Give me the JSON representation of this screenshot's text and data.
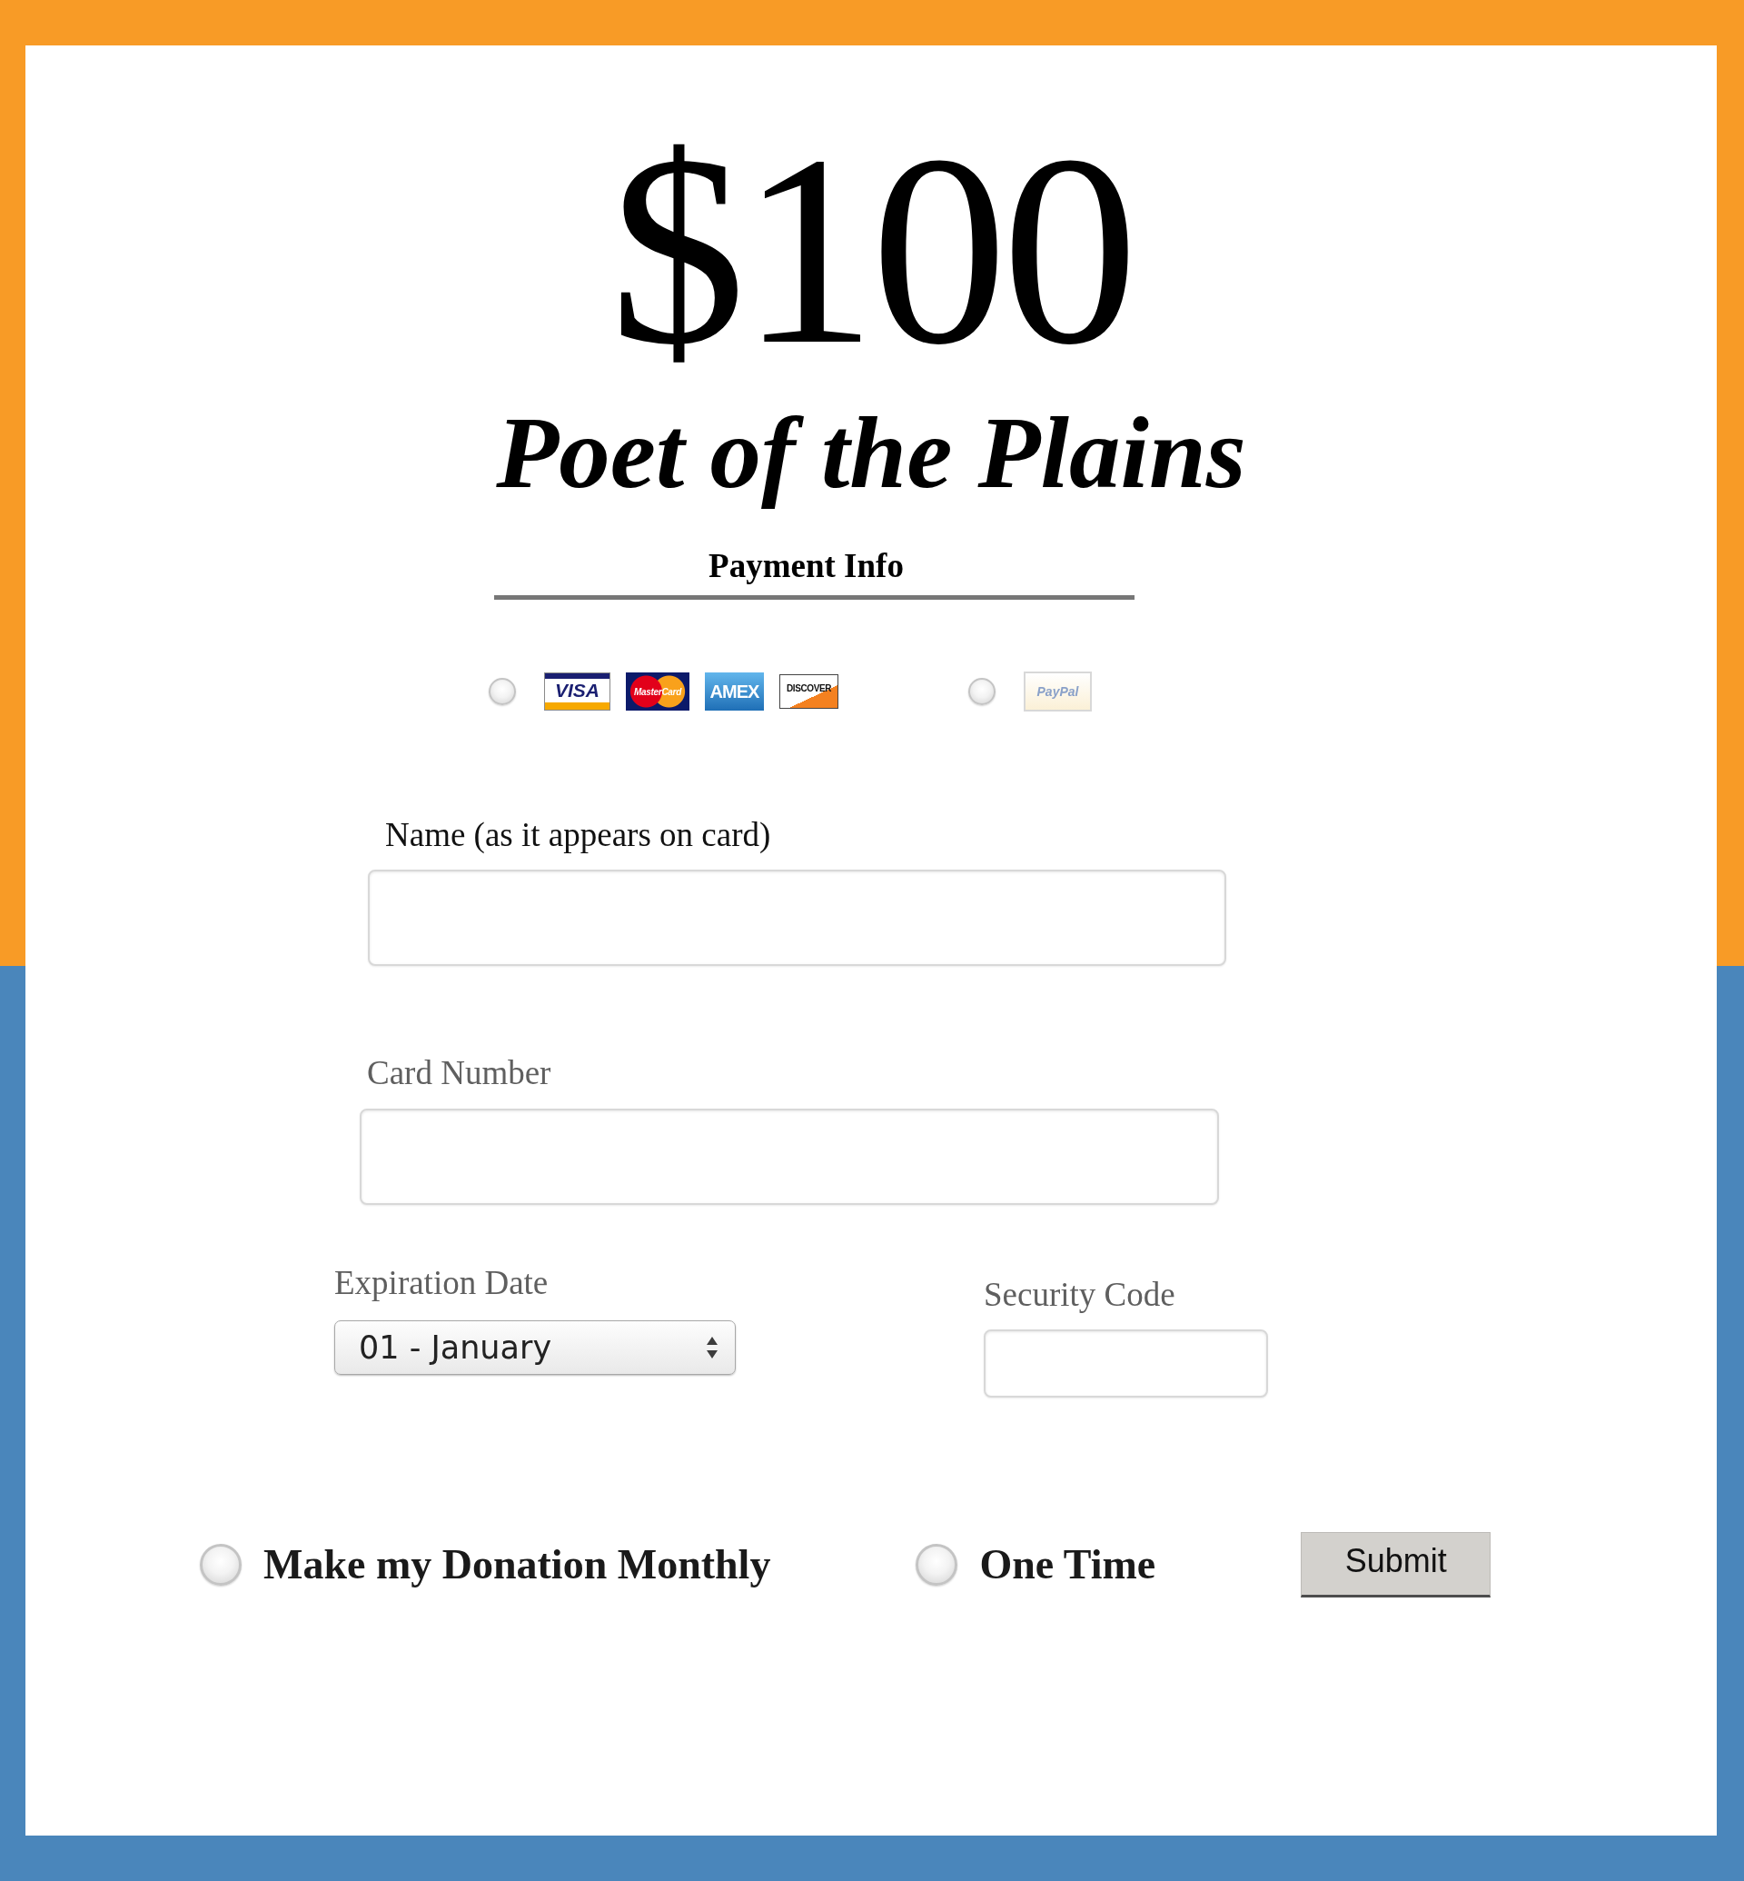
{
  "amount": "$100",
  "title": "Poet of the Plains",
  "payment_heading": "Payment Info",
  "payment_methods": [
    {
      "selected": false,
      "logos": [
        {
          "kind": "visa",
          "text": "VISA"
        },
        {
          "kind": "mastercard",
          "text": "MasterCard"
        },
        {
          "kind": "amex",
          "text": "AMEX"
        },
        {
          "kind": "discover",
          "text": "DISCOVER"
        }
      ]
    },
    {
      "selected": false,
      "logos": [
        {
          "kind": "paypal",
          "text": "PayPal"
        }
      ]
    }
  ],
  "name_field": {
    "label": "Name (as it appears on card)"
  },
  "card_number_field": {
    "label": "Card Number"
  },
  "expiration": {
    "label": "Expiration Date",
    "value": "01 - January"
  },
  "security_code": {
    "label": "Security Code"
  },
  "frequency": [
    {
      "label": "Make my Donation Monthly",
      "selected": false
    },
    {
      "label": "One Time",
      "selected": false
    }
  ],
  "submit": {
    "label": "Submit"
  }
}
